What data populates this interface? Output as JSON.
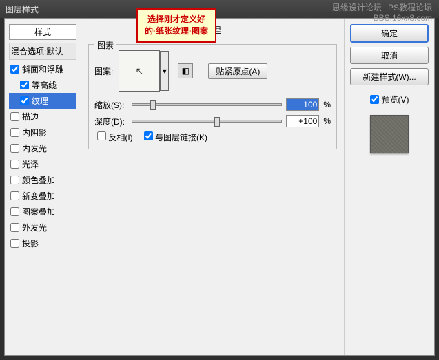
{
  "titlebar": "图层样式",
  "watermark_top": "PS教程论坛",
  "watermark_bottom2": "BBS.16xx8.com",
  "watermark_left": "思缘设计论坛",
  "callout_l1": "选择刚才定义好",
  "callout_l2": "的·纸张纹理·图案",
  "styles_header": "样式",
  "blend_default": "混合选项:默认",
  "opts": {
    "bevel": "斜面和浮雕",
    "contour": "等高线",
    "texture": "纹理",
    "stroke": "描边",
    "inner_shadow": "内阴影",
    "inner_glow": "内发光",
    "satin": "光泽",
    "color_overlay": "颜色叠加",
    "gradient_overlay": "新变叠加",
    "pattern_overlay": "图案叠加",
    "outer_glow": "外发光",
    "drop_shadow": "投影"
  },
  "center": {
    "title": "纹理",
    "legend": "图素",
    "pattern_label": "图案:",
    "snap": "贴紧原点(A)",
    "scale_label": "缩放(S):",
    "scale_value": "100",
    "depth_label": "深度(D):",
    "depth_value": "+100",
    "percent": "%",
    "invert": "反相(I)",
    "link": "与图层链接(K)"
  },
  "right": {
    "ok": "确定",
    "cancel": "取消",
    "new_style": "新建样式(W)...",
    "preview": "预览(V)"
  }
}
